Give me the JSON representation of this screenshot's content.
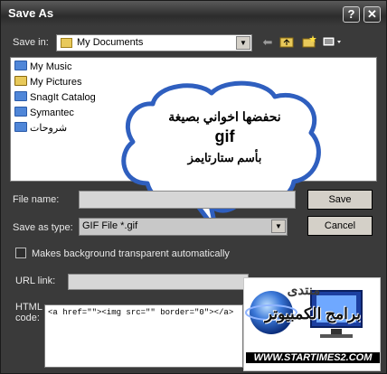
{
  "window": {
    "title": "Save As",
    "help_label": "?",
    "close_label": "✕"
  },
  "save_in": {
    "label": "Save in:",
    "value": "My Documents"
  },
  "files": [
    {
      "name": "My Music",
      "icon": "music-folder-icon"
    },
    {
      "name": "My Pictures",
      "icon": "pictures-folder-icon"
    },
    {
      "name": "SnagIt Catalog",
      "icon": "folder-icon"
    },
    {
      "name": "Symantec",
      "icon": "folder-icon"
    },
    {
      "name": "شروحات",
      "icon": "folder-icon"
    }
  ],
  "file_name": {
    "label": "File name:",
    "value": ""
  },
  "save_as_type": {
    "label": "Save as type:",
    "value": "GIF File *.gif"
  },
  "buttons": {
    "save": "Save",
    "cancel": "Cancel"
  },
  "transparent": {
    "label": "Makes background transparent automatically",
    "checked": false
  },
  "url_link": {
    "label": "URL link:",
    "value": ""
  },
  "html_code": {
    "label": "HTML code:",
    "value": "<a href=\"\"><img src=\"\" border=\"0\"></a>"
  },
  "bubble": {
    "line1": "نحفضها اخواني بصيغة",
    "line2": "gif",
    "line3": "بأسم ستارتايمز"
  },
  "logo": {
    "line1": "منتدى",
    "line2": "برامج الكمبيوتر",
    "url": "WWW.STARTIMES2.COM"
  },
  "colors": {
    "dialog_bg": "#3a3a3a",
    "label_text": "#e8e8e8",
    "folder_blue": "#4f86d8",
    "bubble_fill": "#ffffff",
    "bubble_stroke": "#2f5fbf"
  }
}
